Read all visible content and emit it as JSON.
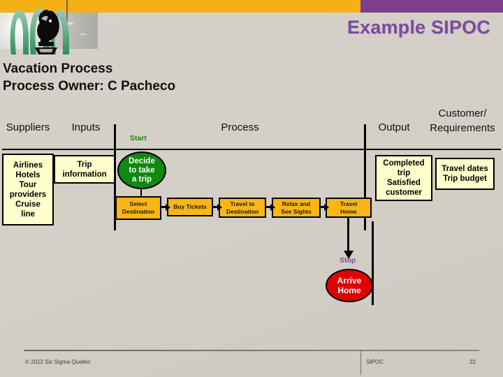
{
  "header": {
    "bar_orange_color": "#f5b014",
    "bar_purple_color": "#7b3f8c",
    "title": "Example SIPOC",
    "title_color": "#7b4a9c",
    "logo_name": "chess-knight-logo"
  },
  "subtitle": {
    "line1": "Vacation Process",
    "line2": "Process Owner: C Pacheco"
  },
  "columns": {
    "suppliers": "Suppliers",
    "inputs": "Inputs",
    "process": "Process",
    "output": "Output",
    "customer_requirements": "Customer/\nRequirements"
  },
  "boxes": {
    "suppliers": "Airlines\nHotels\nTour\nproviders\nCruise\nline",
    "inputs": "Trip\ninformation",
    "output": "Completed\ntrip\nSatisfied\ncustomer",
    "customer_requirements": "Travel dates\nTrip budget",
    "fill_color": "#ffffcc"
  },
  "flow": {
    "start_label": "Start",
    "start_label_color": "#1a8a1a",
    "start_node": "Decide\nto take\na trip",
    "start_node_color": "#118811",
    "stop_label": "Stop",
    "stop_label_color": "#7b4a9c",
    "stop_node": "Arrive\nHome",
    "stop_node_color": "#e00000",
    "step_fill_color": "#fcb614",
    "steps": [
      "Select\nDestination",
      "Buy Tickets",
      "Travel to\nDestination",
      "Relax and\nSee Sights",
      "Travel\nHome"
    ]
  },
  "footer": {
    "copyright": "© 2012 Six Sigma Qualtec",
    "section": "SIPOC",
    "page": "22"
  }
}
